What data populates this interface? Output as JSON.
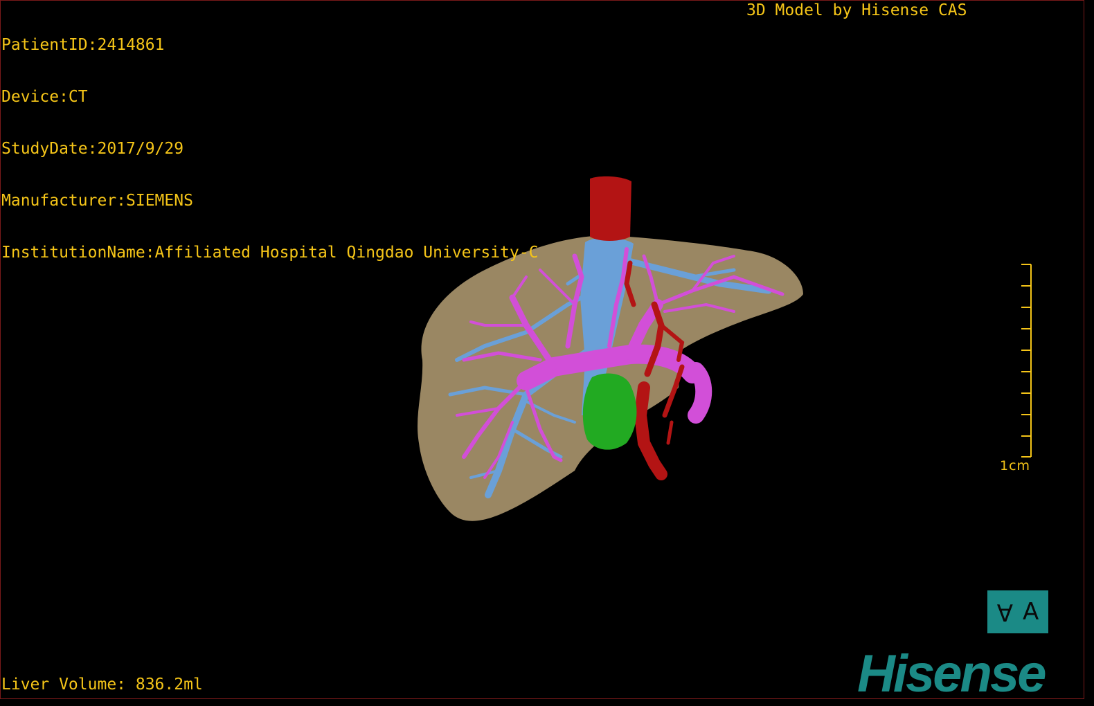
{
  "patient_info": {
    "patient_id": "PatientID:2414861",
    "device": "Device:CT",
    "study_date": "StudyDate:2017/9/29",
    "manufacturer": "Manufacturer:SIEMENS",
    "institution": "InstitutionName:Affiliated Hospital Qingdao University-C"
  },
  "header": {
    "model_credit": "3D Model by Hisense CAS"
  },
  "footer": {
    "liver_volume": "Liver Volume: 836.2ml"
  },
  "scale_bar": {
    "label": "1cm"
  },
  "orientation_cube": {
    "left_glyph": "A",
    "right_glyph": "A"
  },
  "logo": {
    "text": "Hisense"
  },
  "colors": {
    "overlay_text": "#f5c518",
    "liver": "#a08c67",
    "hepatic_vein": "#6aa0d8",
    "portal_vein": "#d24fd8",
    "artery": "#b31414",
    "tumor": "#22aa22",
    "brand": "#1b8a86"
  },
  "icons": [
    "liver-model",
    "orientation-cube-icon",
    "hisense-logo"
  ]
}
